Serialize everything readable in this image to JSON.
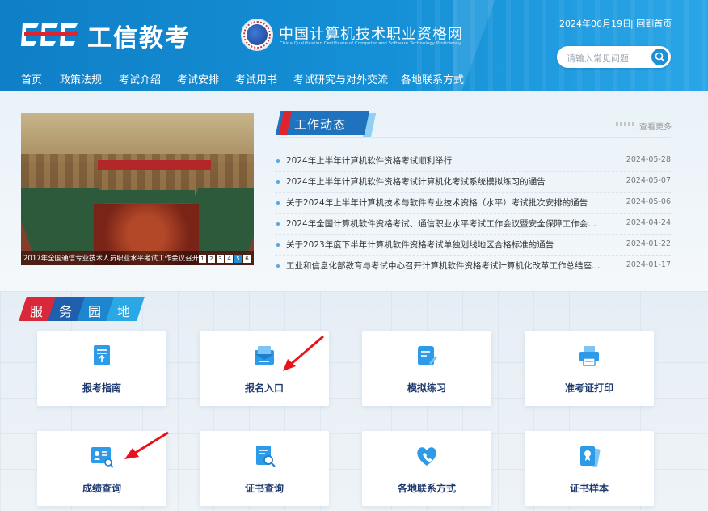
{
  "header": {
    "logo_text": "工信教考",
    "site_title": "中国计算机技术职业资格网",
    "site_subtitle": "China Qualification Certificate of Computer and Software Technology Proficiency",
    "date": "2024年06月19日",
    "home_link": "| 回到首页",
    "search_placeholder": "请输入常见问题",
    "nav": [
      "首页",
      "政策法规",
      "考试介绍",
      "考试安排",
      "考试用书",
      "考试研究与对外交流",
      "各地联系方式"
    ],
    "active_nav": "首页"
  },
  "slideshow": {
    "caption": "2017年全国通信专业技术人员职业水平考试工作会议召开",
    "pages": [
      "1",
      "2",
      "3",
      "4",
      "5",
      "6"
    ],
    "current_page": "5"
  },
  "news": {
    "title": "工作动态",
    "more_label": "查看更多",
    "items": [
      {
        "title": "2024年上半年计算机软件资格考试顺利举行",
        "date": "2024-05-28"
      },
      {
        "title": "2024年上半年计算机软件资格考试计算机化考试系统模拟练习的通告",
        "date": "2024-05-07"
      },
      {
        "title": "关于2024年上半年计算机技术与软件专业技术资格（水平）考试批次安排的通告",
        "date": "2024-05-06"
      },
      {
        "title": "2024年全国计算机软件资格考试、通信职业水平考试工作会议暨安全保障工作会…",
        "date": "2024-04-24"
      },
      {
        "title": "关于2023年度下半年计算机软件资格考试单独划线地区合格标准的通告",
        "date": "2024-01-22"
      },
      {
        "title": "工业和信息化部教育与考试中心召开计算机软件资格考试计算机化改革工作总结座…",
        "date": "2024-01-17"
      }
    ]
  },
  "services": {
    "title_chars": [
      "服",
      "务",
      "园",
      "地"
    ],
    "title_colors": [
      "#d8283a",
      "#1f5fae",
      "#1d86cf",
      "#2aa8e6"
    ],
    "cards": [
      {
        "label": "报考指南",
        "icon": "guide-doc-icon"
      },
      {
        "label": "报名入口",
        "icon": "registration-mail-icon"
      },
      {
        "label": "模拟练习",
        "icon": "practice-edit-icon"
      },
      {
        "label": "准考证打印",
        "icon": "printer-icon"
      },
      {
        "label": "成绩查询",
        "icon": "score-card-icon"
      },
      {
        "label": "证书查询",
        "icon": "certificate-search-icon"
      },
      {
        "label": "各地联系方式",
        "icon": "contact-heart-icon"
      },
      {
        "label": "证书样本",
        "icon": "certificate-sample-icon"
      }
    ]
  }
}
